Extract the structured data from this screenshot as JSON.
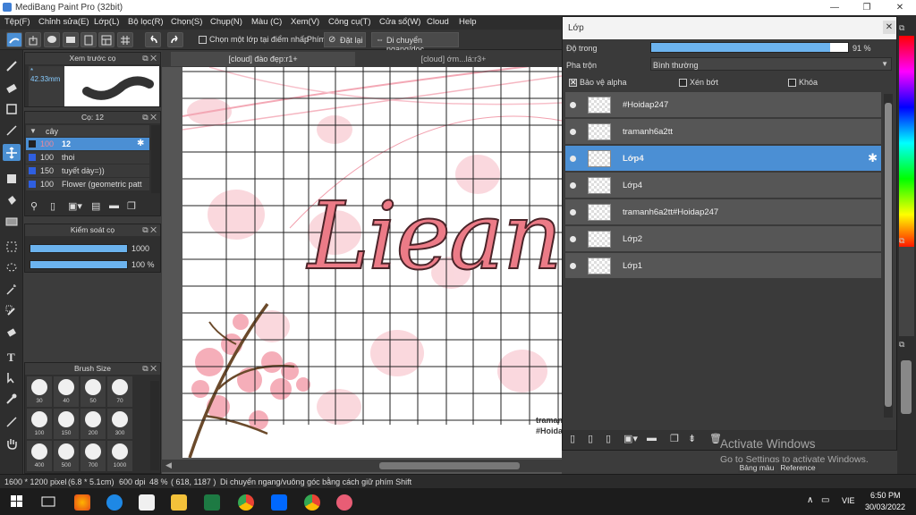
{
  "window": {
    "title": "MediBang Paint Pro (32bit)"
  },
  "menu": [
    "Tệp(F)",
    "Chỉnh sửa(E)",
    "Lớp(L)",
    "Bộ lọc(R)",
    "Chọn(S)",
    "Chụp(N)",
    "Màu (C)",
    "Xem(V)",
    "Công cụ(T)",
    "Cửa sổ(W)",
    "Cloud",
    "Help"
  ],
  "toolbar": {
    "select_one_layer": "Chọn một lớp tại điểm nhấp",
    "key_label": "Phím",
    "reset": "Đặt lại",
    "move_hv": "Di chuyển ngang/dọc"
  },
  "preview_panel": {
    "title": "Xem trước cọ",
    "size": "* 42.33mm"
  },
  "brush_panel": {
    "title": "Cọ: 12",
    "group": "cây",
    "items": [
      {
        "size": "100",
        "name": "12",
        "selected": true
      },
      {
        "size": "100",
        "name": "thoi"
      },
      {
        "size": "150",
        "name": "tuyết dày=))"
      },
      {
        "size": "100",
        "name": "Flower (geometric patt"
      }
    ]
  },
  "brush_control": {
    "title": "Kiểm soát cọ",
    "size_value": "1000",
    "opacity_value": "100 %",
    "size_fill": 1.0,
    "opacity_fill": 1.0
  },
  "brush_size": {
    "title": "Brush Size",
    "sizes": [
      "30",
      "40",
      "50",
      "70",
      "100",
      "150",
      "200",
      "300",
      "400",
      "500",
      "700",
      "1000"
    ]
  },
  "canvas": {
    "tabs": [
      "[cloud] đào đẹp:r1+",
      "[cloud] ớm...lá:r3+"
    ],
    "art_text": "Liean",
    "watermark_1": "traman",
    "watermark_2": "#Hoidap"
  },
  "layer_panel": {
    "title": "Lớp",
    "opacity_label": "Độ trong",
    "opacity_value": "91 %",
    "opacity_fill": 0.91,
    "blend_label": "Pha trộn",
    "blend_value": "Bình thường",
    "protect_alpha": "Bảo vệ alpha",
    "clipping": "Xén bớt",
    "lock": "Khóa",
    "layers": [
      {
        "name": "#Hoidap247"
      },
      {
        "name": "tramanh6a2tt"
      },
      {
        "name": "Lớp4",
        "selected": true
      },
      {
        "name": "Lớp4"
      },
      {
        "name": "tramanh6a2tt#Hoidap247"
      },
      {
        "name": "Lớp2"
      },
      {
        "name": "Lớp1"
      }
    ]
  },
  "activate": {
    "title": "Activate Windows",
    "subtitle": "Go to Settings to activate Windows."
  },
  "bottom_tabs": [
    "Bảng màu",
    "Reference"
  ],
  "status": {
    "dimensions": "1600 * 1200 pixel",
    "physical": "(6.8 * 5.1cm)",
    "dpi": "600 dpi",
    "zoom": "48 %",
    "coords": "( 618, 1187 )",
    "hint": "Di chuyển ngang/vuông góc bằng cách giữ phím Shift"
  },
  "taskbar": {
    "lang": "VIE",
    "time": "6:50 PM",
    "date": "30/03/2022"
  },
  "colors": {
    "accent": "#4b8fd4",
    "panel": "#2f2f2f",
    "selected_layer": "#4b8fd4"
  }
}
